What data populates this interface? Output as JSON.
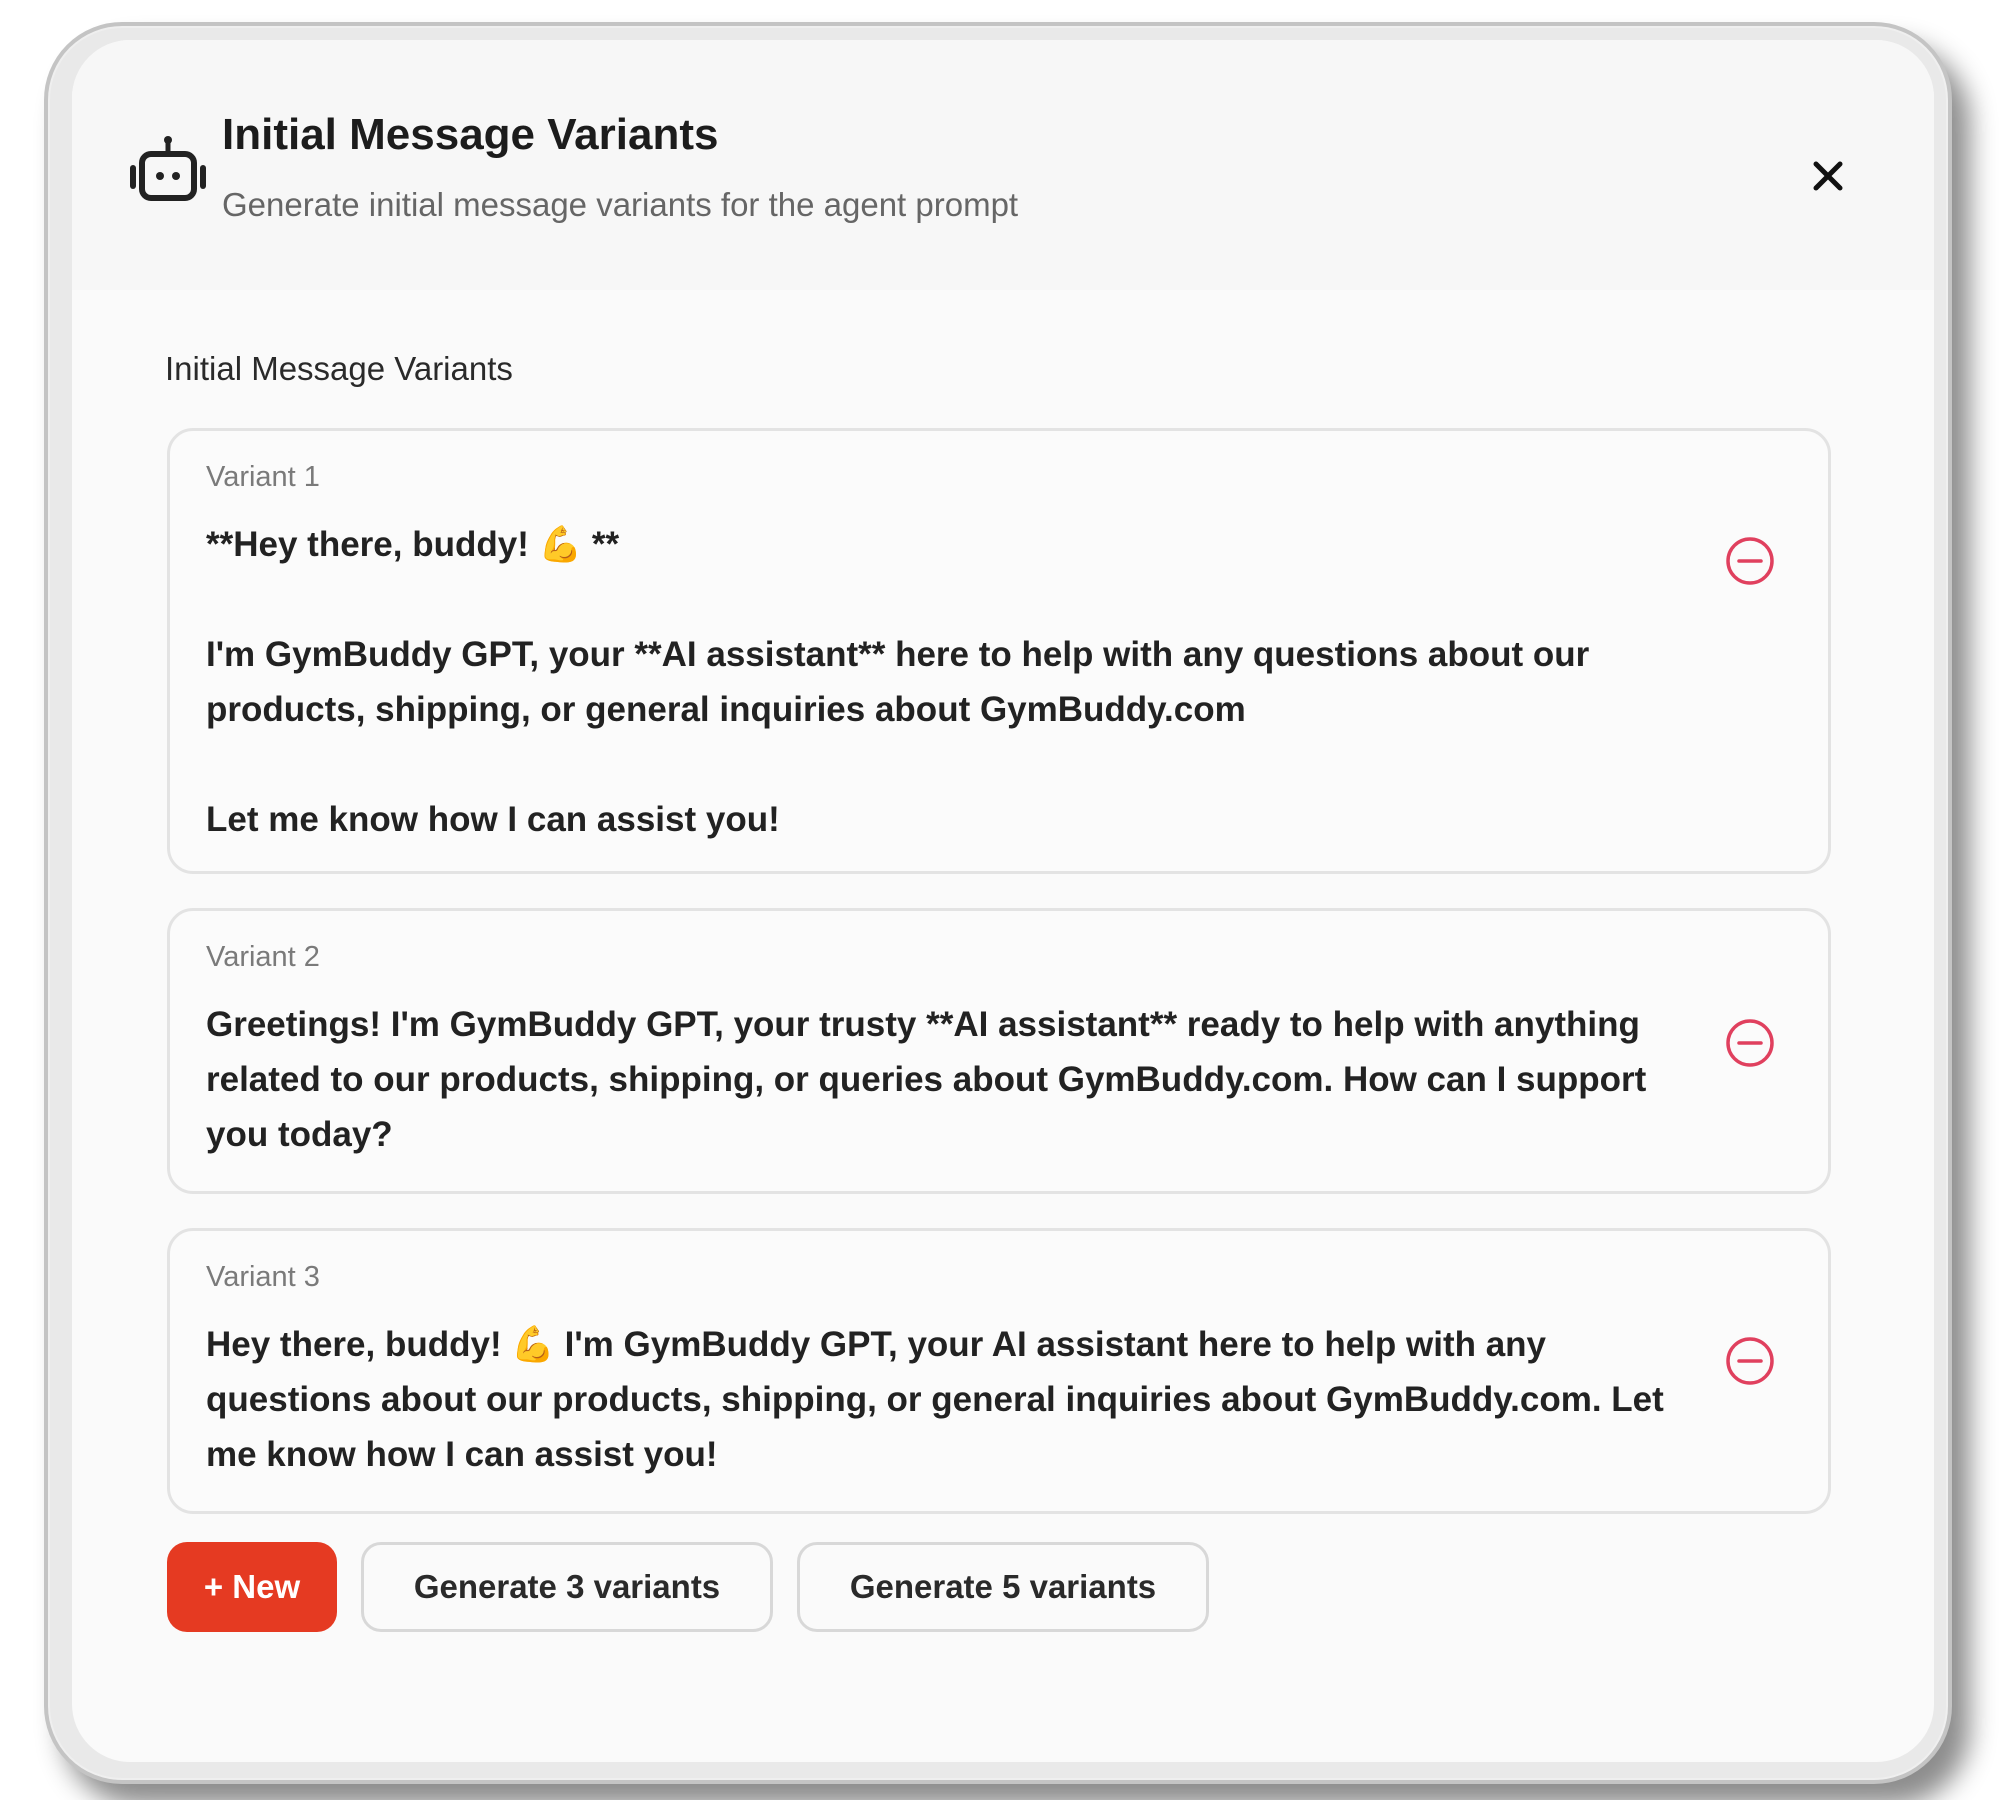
{
  "dialog": {
    "title": "Initial Message Variants",
    "subtitle": "Generate initial message variants for the agent prompt",
    "close_icon": "close-icon",
    "header_icon": "robot-icon"
  },
  "section": {
    "label": "Initial Message Variants"
  },
  "variants": [
    {
      "label": "Variant 1",
      "text": "**Hey there, buddy! 💪 **\n\nI'm GymBuddy GPT, your **AI assistant** here to help with any questions about our products, shipping, or general inquiries about GymBuddy.com\n\nLet me know how I can assist you!"
    },
    {
      "label": "Variant 2",
      "text": "Greetings! I'm GymBuddy GPT, your trusty **AI assistant** ready to help with anything related to our products, shipping, or queries about GymBuddy.com. How can I support you today?"
    },
    {
      "label": "Variant 3",
      "text": "Hey there, buddy! 💪 I'm GymBuddy GPT, your AI assistant here to help with any questions about our products, shipping, or general inquiries about GymBuddy.com. Let me know how I can assist you!"
    }
  ],
  "actions": {
    "new_label": "+ New",
    "generate3_label": "Generate 3 variants",
    "generate5_label": "Generate 5 variants"
  },
  "colors": {
    "accent": "#e53a22",
    "remove_icon": "#e0405e"
  }
}
